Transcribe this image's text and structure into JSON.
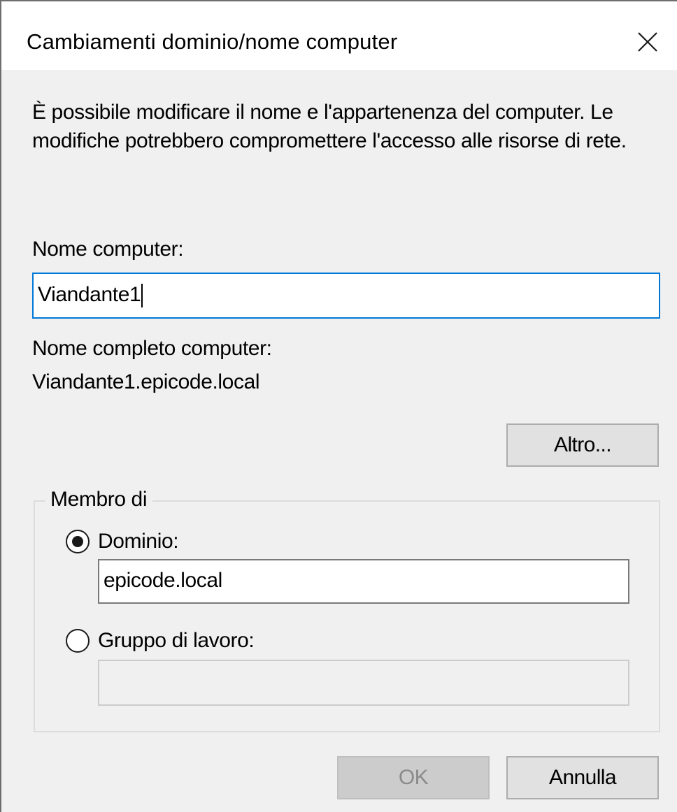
{
  "dialog": {
    "title": "Cambiamenti dominio/nome computer",
    "close_icon": "close-icon"
  },
  "description": "È possibile modificare il nome e l'appartenenza del computer. Le modifiche potrebbero compromettere l'accesso alle risorse di rete.",
  "computer_name": {
    "label": "Nome computer:",
    "value": "Viandante1"
  },
  "full_name": {
    "label": "Nome completo computer:",
    "value": "Viandante1.epicode.local"
  },
  "more_button": "Altro...",
  "member_of": {
    "legend": "Membro di",
    "domain": {
      "label": "Dominio:",
      "value": "epicode.local",
      "selected": true
    },
    "workgroup": {
      "label": "Gruppo di lavoro:",
      "value": "",
      "selected": false
    }
  },
  "buttons": {
    "ok": "OK",
    "cancel": "Annulla"
  },
  "colors": {
    "focus_border": "#0078d7",
    "dialog_bg": "#f0f0f0",
    "button_bg": "#e1e1e1"
  }
}
